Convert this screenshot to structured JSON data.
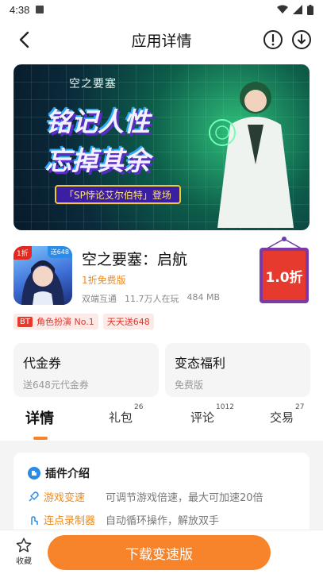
{
  "status": {
    "time": "4:38"
  },
  "header": {
    "title": "应用详情"
  },
  "banner": {
    "logo_text": "空之要塞",
    "slogan_line1": "铭记人性",
    "slogan_line2": "忘掉其余",
    "ribbon": "「SP悖论艾尔伯特」登场"
  },
  "app": {
    "name": "空之要塞：启航",
    "subtitle": "1折免费版",
    "meta": [
      "双端互通",
      "11.7万人在玩",
      "484 MB"
    ],
    "icon_tag_left": "1折",
    "icon_tag_right": "送648",
    "discount_badge": "1.0折"
  },
  "tags": [
    {
      "prefix": "BT",
      "label": "角色扮演 No.1"
    },
    {
      "prefix": "",
      "label": "天天送648"
    }
  ],
  "cards": [
    {
      "title": "代金券",
      "sub": "送648元代金券"
    },
    {
      "title": "变态福利",
      "sub": "免费版"
    }
  ],
  "tabs": [
    {
      "label": "详情",
      "count": ""
    },
    {
      "label": "礼包",
      "count": "26"
    },
    {
      "label": "评论",
      "count": "1012"
    },
    {
      "label": "交易",
      "count": "27"
    }
  ],
  "plugin": {
    "title": "插件介绍",
    "rows": [
      {
        "name": "游戏变速",
        "desc": "可调节游戏倍速，最大可加速20倍"
      },
      {
        "name": "连点录制器",
        "desc": "自动循环操作，解放双手"
      }
    ]
  },
  "bottom": {
    "fav_label": "收藏",
    "download_label": "下载变速版"
  },
  "colors": {
    "accent": "#f7842b",
    "discount_red": "#e63a2e",
    "tab_indicator": "#f7832a"
  }
}
